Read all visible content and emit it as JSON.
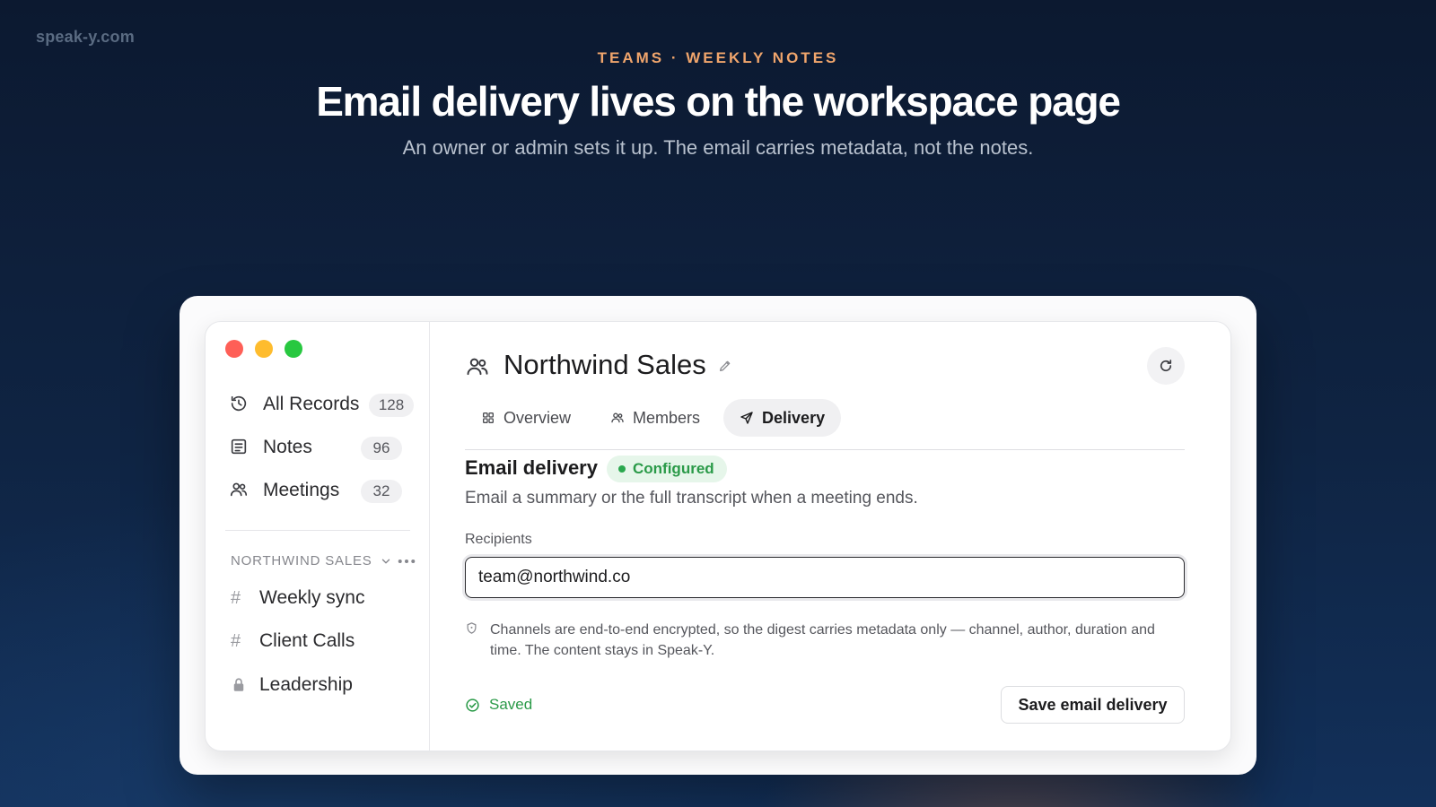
{
  "brand": "speak-y.com",
  "hero": {
    "eyebrow": "TEAMS · WEEKLY NOTES",
    "headline": "Email delivery lives on the workspace page",
    "subhead": "An owner or admin sets it up. The email carries metadata, not the notes."
  },
  "sidebar": {
    "nav": [
      {
        "label": "All Records",
        "count": "128",
        "icon": "history-icon"
      },
      {
        "label": "Notes",
        "count": "96",
        "icon": "note-icon"
      },
      {
        "label": "Meetings",
        "count": "32",
        "icon": "people-icon"
      }
    ],
    "section_title": "NORTHWIND SALES",
    "channels": [
      {
        "label": "Weekly sync",
        "icon": "hash-icon"
      },
      {
        "label": "Client Calls",
        "icon": "hash-icon"
      },
      {
        "label": "Leadership",
        "icon": "lock-icon"
      }
    ],
    "hash_glyph": "#"
  },
  "workspace": {
    "title": "Northwind Sales",
    "tabs": [
      {
        "label": "Overview",
        "icon": "grid-icon"
      },
      {
        "label": "Members",
        "icon": "people-icon"
      },
      {
        "label": "Delivery",
        "icon": "send-icon"
      }
    ],
    "active_tab": "Delivery"
  },
  "delivery": {
    "title": "Email delivery",
    "status": "Configured",
    "description": "Email a summary or the full transcript when a meeting ends.",
    "recipients_label": "Recipients",
    "recipients_value": "team@northwind.co",
    "note": "Channels are end-to-end encrypted, so the digest carries metadata only — channel, author, duration and time. The content stays in Speak-Y.",
    "saved_label": "Saved",
    "save_button": "Save email delivery"
  },
  "colors": {
    "accent_orange": "#f0a56c",
    "success_green": "#2a9a48",
    "traffic_red": "#fe5f57",
    "traffic_yellow": "#febc2e",
    "traffic_green": "#28c840"
  }
}
